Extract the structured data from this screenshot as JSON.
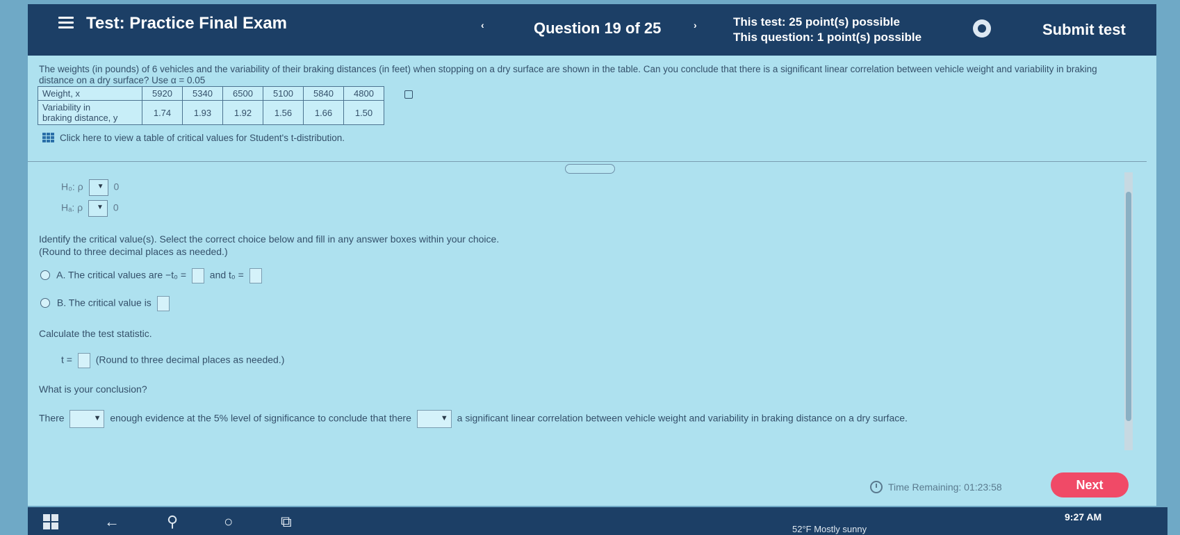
{
  "header": {
    "title": "Test: Practice Final Exam",
    "prev_arrow": "‹",
    "question_counter": "Question 19 of 25",
    "next_arrow": "›",
    "points_test": "This test: 25 point(s) possible",
    "points_question": "This question: 1 point(s) possible",
    "submit_label": "Submit test"
  },
  "question": {
    "text": "The weights (in pounds) of 6 vehicles and the variability of their braking distances (in feet) when stopping on a dry surface are shown in the table. Can you conclude that there is a significant linear correlation between vehicle weight and variability in braking distance on a dry surface? Use α = 0.05",
    "table": {
      "row1_label": "Weight, x",
      "row1_values": [
        "5920",
        "5340",
        "6500",
        "5100",
        "5840",
        "4800"
      ],
      "row2_label_a": "Variability in",
      "row2_label_b": "braking distance, y",
      "row2_values": [
        "1.74",
        "1.93",
        "1.92",
        "1.56",
        "1.66",
        "1.50"
      ]
    },
    "critical_link": "Click here to view a table of critical values for Student's t-distribution."
  },
  "hypotheses": {
    "h0_label": "H₀: ρ",
    "ha_label": "Hₐ: ρ",
    "h0_value": "0",
    "ha_value": "0"
  },
  "critical": {
    "instruction": "Identify the critical value(s). Select the correct choice below and fill in any answer boxes within your choice.",
    "round_note": "(Round to three decimal places as needed.)",
    "choice_a_letter": "A.",
    "choice_a_text": "The critical values are  −t₀ =",
    "choice_a_and": "and t₀ =",
    "choice_b_letter": "B.",
    "choice_b_text": "The critical value is"
  },
  "test_statistic": {
    "instruction": "Calculate the test statistic.",
    "t_label": "t =",
    "round_note": "(Round to three decimal places as needed.)"
  },
  "conclusion": {
    "question": "What is your conclusion?",
    "there": "There",
    "middle": "enough evidence at the 5% level of significance to conclude that there",
    "end": "a significant linear correlation between vehicle weight and variability in braking distance on a dry surface."
  },
  "footer": {
    "time_remaining": "Time Remaining: 01:23:58",
    "next_label": "Next"
  },
  "taskbar": {
    "weather": "52°F  Mostly sunny",
    "clock": "9:27 AM"
  }
}
